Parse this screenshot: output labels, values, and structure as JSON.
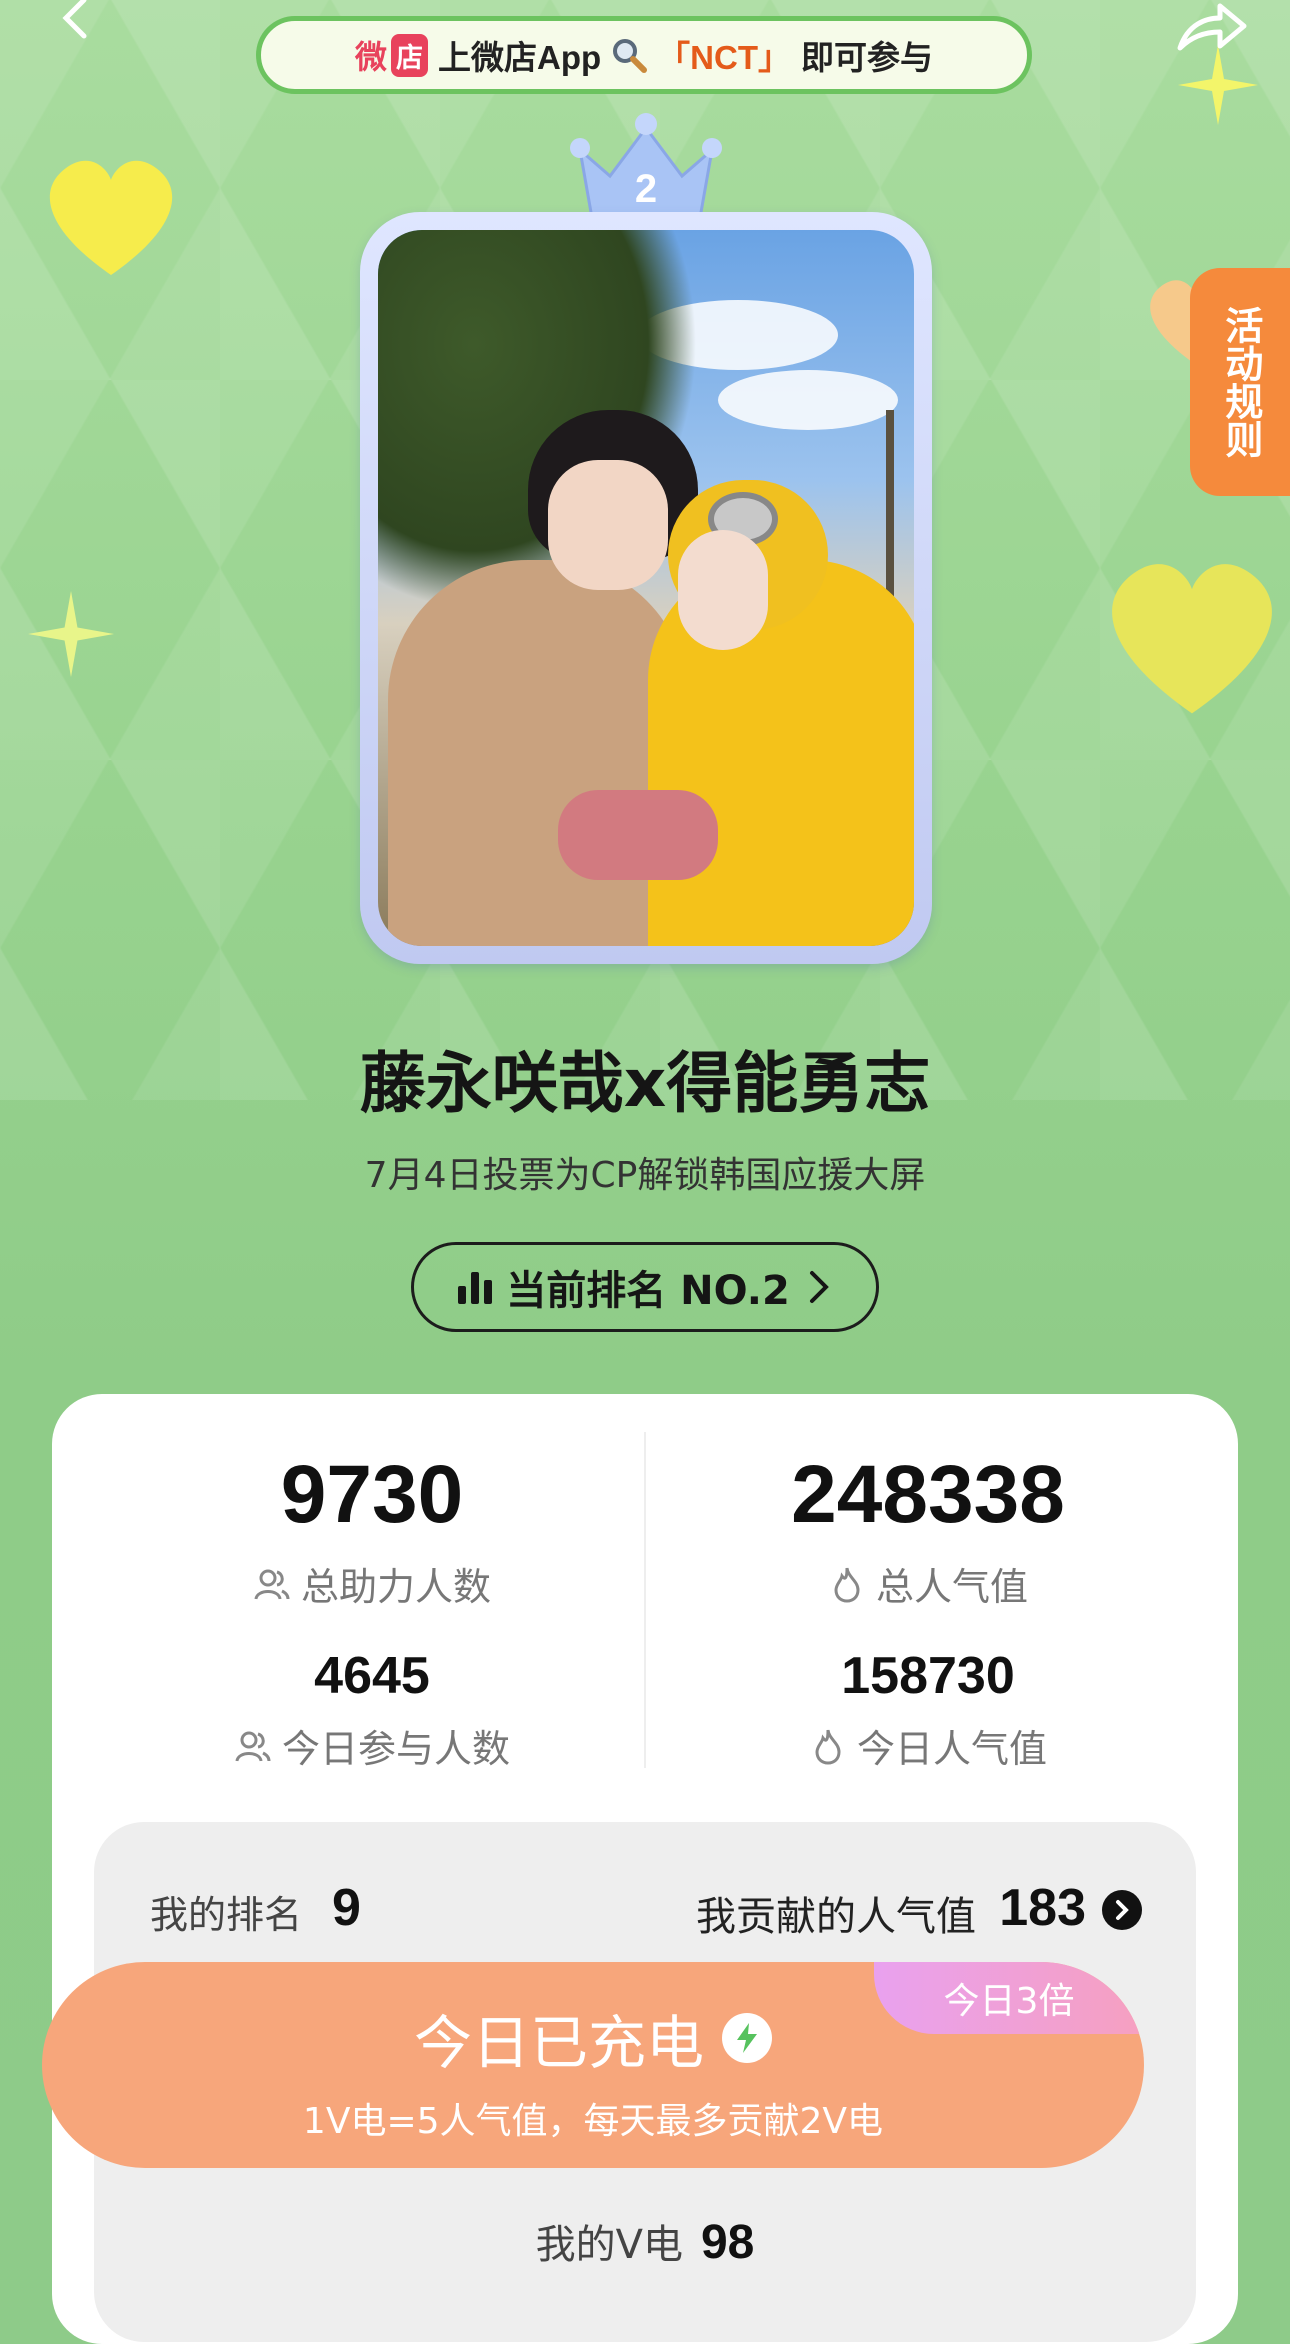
{
  "promo": {
    "weidian_wei": "微",
    "weidian_dian": "店",
    "text_prefix": "上微店App",
    "keyword": "「NCT」",
    "text_suffix": "即可参与"
  },
  "crown": {
    "rank_number": "2"
  },
  "header": {
    "title": "藤永咲哉x得能勇志",
    "subtitle": "7月4日投票为CP解锁韩国应援大屏"
  },
  "rank_pill": {
    "label": "当前排名 NO.2"
  },
  "rules_tab": {
    "label": "活动规则"
  },
  "stats": {
    "total_supporters": {
      "value": "9730",
      "label": "总助力人数"
    },
    "total_popularity": {
      "value": "248338",
      "label": "总人气值"
    },
    "today_participants": {
      "value": "4645",
      "label": "今日参与人数"
    },
    "today_popularity": {
      "value": "158730",
      "label": "今日人气值"
    }
  },
  "mine": {
    "rank_label": "我的排名",
    "rank_value": "9",
    "contrib_label": "我贡献的人气值",
    "contrib_value": "183"
  },
  "charge": {
    "title": "今日已充电",
    "badge": "今日3倍",
    "subtitle": "1V电=5人气值，每天最多贡献2V电"
  },
  "vdian": {
    "label": "我的V电",
    "value": "98"
  },
  "colors": {
    "bg_green": "#8ecb89",
    "accent_orange": "#f58a3c",
    "charge_peach": "#f7a67b",
    "badge_pink": "#e9a1ef"
  }
}
